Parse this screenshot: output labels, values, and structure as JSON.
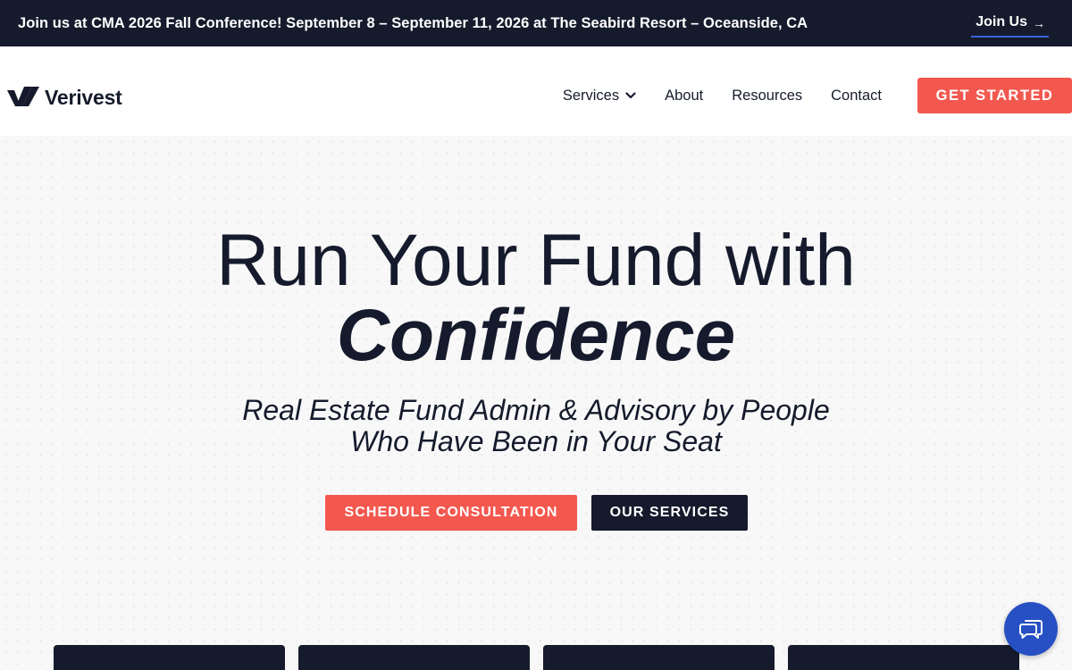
{
  "announcement": {
    "text": "Join us at CMA 2026 Fall Conference! September 8 – September 11, 2026 at The Seabird Resort – Oceanside, CA",
    "link_label": "Join Us",
    "link_arrow": "→",
    "link_underline_color": "#3a63d8"
  },
  "header": {
    "logo_text": "Verivest",
    "nav": [
      {
        "label": "Services",
        "has_dropdown": true
      },
      {
        "label": "About"
      },
      {
        "label": "Resources"
      },
      {
        "label": "Contact"
      }
    ],
    "cta_label": "GET STARTED"
  },
  "hero": {
    "title_line1": "Run Your Fund with",
    "title_line2": "Confidence",
    "subtitle_line1": "Real Estate Fund Admin & Advisory by People",
    "subtitle_line2": "Who Have Been in Your Seat",
    "primary_button": "SCHEDULE CONSULTATION",
    "secondary_button": "OUR SERVICES"
  },
  "chat": {
    "icon": "chat-bubbles-icon"
  },
  "colors": {
    "navy": "#151b2c",
    "coral": "#f3584f",
    "chat_blue": "#2750c4",
    "background": "#f8f8f8"
  }
}
